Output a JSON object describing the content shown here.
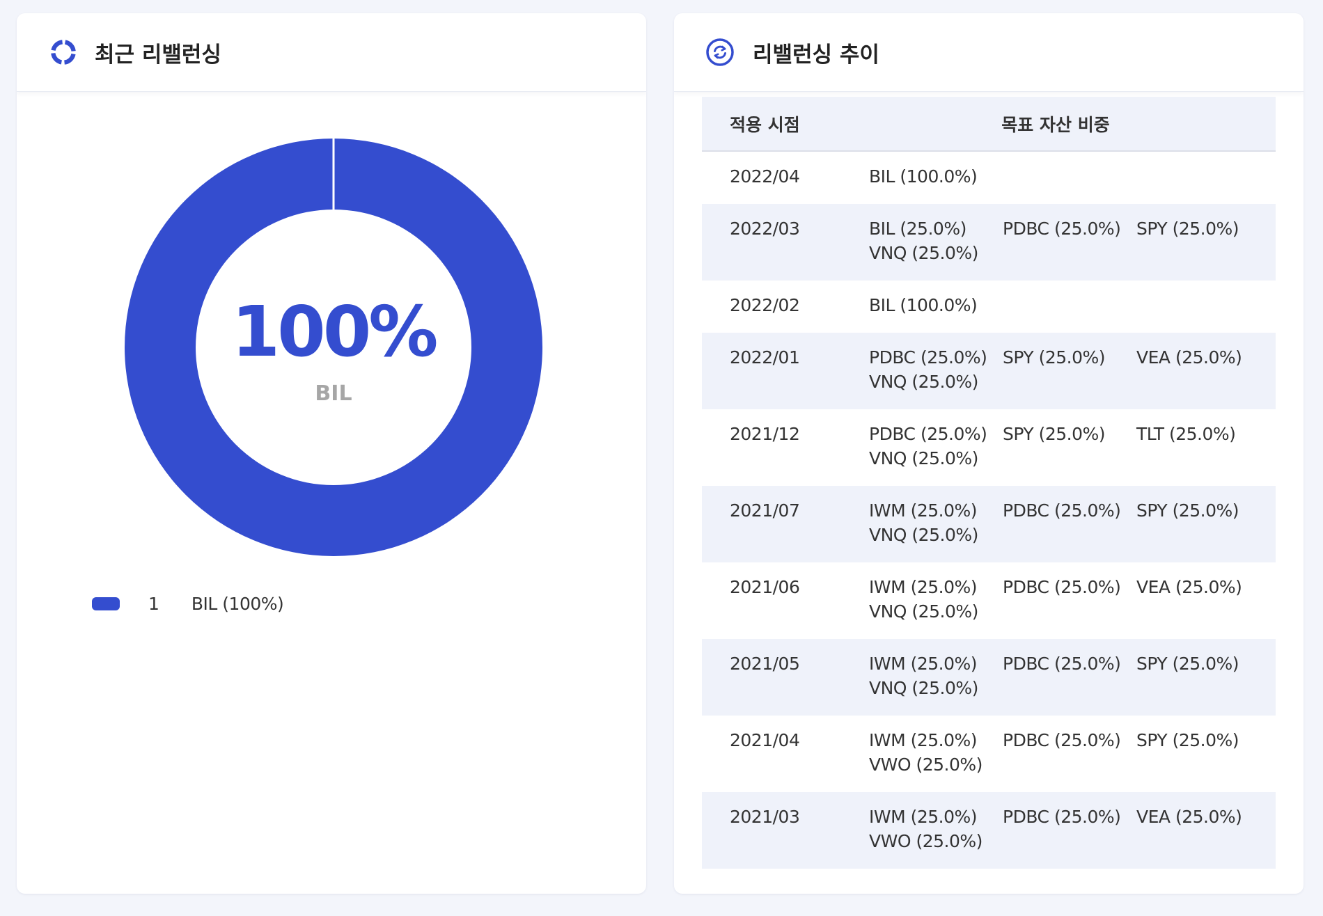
{
  "left_card": {
    "title": "최근 리밸런싱",
    "icon": "donut-ring-icon",
    "chart_data": {
      "type": "pie",
      "labels": [
        "BIL"
      ],
      "values": [
        100
      ],
      "center_value": "100%",
      "center_label": "BIL",
      "colors": [
        "#344dcf"
      ]
    },
    "legend": [
      {
        "index": "1",
        "label": "BIL (100%)",
        "color": "#344dcf"
      }
    ]
  },
  "right_card": {
    "title": "리밸런싱 추이",
    "icon": "refresh-circle-icon",
    "table": {
      "headers": {
        "date": "적용 시점",
        "weights": "목표 자산 비중"
      },
      "rows": [
        {
          "date": "2022/04",
          "weights": [
            "BIL (100.0%)"
          ]
        },
        {
          "date": "2022/03",
          "weights": [
            "BIL (25.0%)",
            "PDBC (25.0%)",
            "SPY (25.0%)",
            "VNQ (25.0%)"
          ]
        },
        {
          "date": "2022/02",
          "weights": [
            "BIL (100.0%)"
          ]
        },
        {
          "date": "2022/01",
          "weights": [
            "PDBC (25.0%)",
            "SPY (25.0%)",
            "VEA (25.0%)",
            "VNQ (25.0%)"
          ]
        },
        {
          "date": "2021/12",
          "weights": [
            "PDBC (25.0%)",
            "SPY (25.0%)",
            "TLT (25.0%)",
            "VNQ (25.0%)"
          ]
        },
        {
          "date": "2021/07",
          "weights": [
            "IWM (25.0%)",
            "PDBC (25.0%)",
            "SPY (25.0%)",
            "VNQ (25.0%)"
          ]
        },
        {
          "date": "2021/06",
          "weights": [
            "IWM (25.0%)",
            "PDBC (25.0%)",
            "VEA (25.0%)",
            "VNQ (25.0%)"
          ]
        },
        {
          "date": "2021/05",
          "weights": [
            "IWM (25.0%)",
            "PDBC (25.0%)",
            "SPY (25.0%)",
            "VNQ (25.0%)"
          ]
        },
        {
          "date": "2021/04",
          "weights": [
            "IWM (25.0%)",
            "PDBC (25.0%)",
            "SPY (25.0%)",
            "VWO (25.0%)"
          ]
        },
        {
          "date": "2021/03",
          "weights": [
            "IWM (25.0%)",
            "PDBC (25.0%)",
            "VEA (25.0%)",
            "VWO (25.0%)"
          ]
        }
      ]
    }
  },
  "colors": {
    "accent": "#344dcf",
    "page_background": "#f3f5fb",
    "row_alt_background": "#eff2fa",
    "muted_text": "#a6a6a6"
  }
}
